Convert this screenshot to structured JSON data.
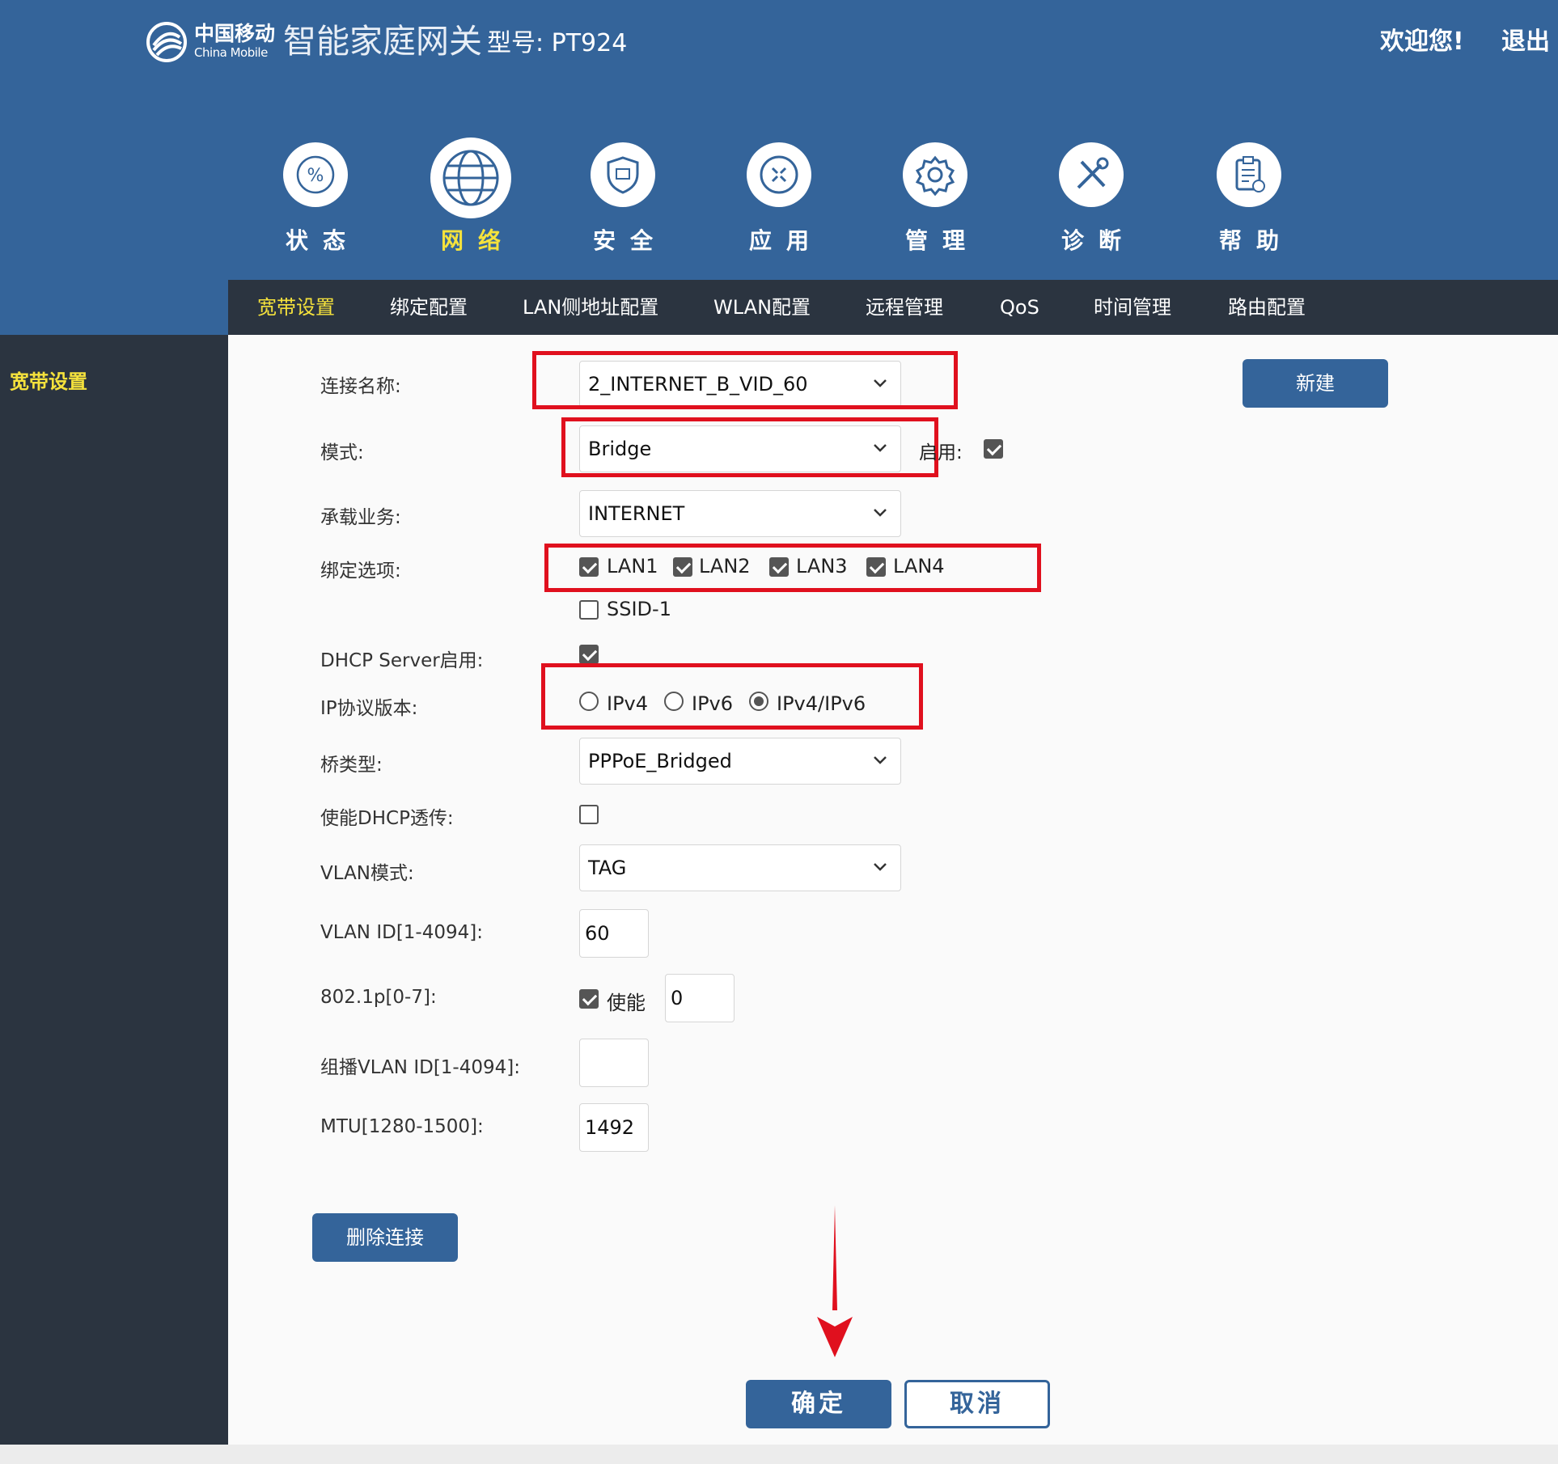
{
  "header": {
    "brand_cn": "中国移动",
    "brand_en": "China Mobile",
    "gateway_title": "智能家庭网关",
    "model": "型号: PT924",
    "welcome": "欢迎您!",
    "logout": "退出"
  },
  "nav": [
    {
      "label": "状态",
      "icon": "status-icon",
      "active": false
    },
    {
      "label": "网络",
      "icon": "globe-icon",
      "active": true
    },
    {
      "label": "安全",
      "icon": "shield-icon",
      "active": false
    },
    {
      "label": "应用",
      "icon": "apps-icon",
      "active": false
    },
    {
      "label": "管理",
      "icon": "gear-icon",
      "active": false
    },
    {
      "label": "诊断",
      "icon": "tools-icon",
      "active": false
    },
    {
      "label": "帮助",
      "icon": "clipboard-icon",
      "active": false
    }
  ],
  "subnav": [
    "宽带设置",
    "绑定配置",
    "LAN侧地址配置",
    "WLAN配置",
    "远程管理",
    "QoS",
    "时间管理",
    "路由配置"
  ],
  "sidebar": {
    "item": "宽带设置"
  },
  "form": {
    "connection_name_label": "连接名称:",
    "connection_name": "2_INTERNET_B_VID_60",
    "new_button": "新建",
    "mode_label": "模式:",
    "mode": "Bridge",
    "enable_label": "启用:",
    "service_label": "承载业务:",
    "service": "INTERNET",
    "binding_label": "绑定选项:",
    "binding_options": [
      "LAN1",
      "LAN2",
      "LAN3",
      "LAN4",
      "SSID-1"
    ],
    "dhcp_server_label": "DHCP Server启用:",
    "ip_version_label": "IP协议版本:",
    "ip_versions": [
      "IPv4",
      "IPv6",
      "IPv4/IPv6"
    ],
    "bridge_type_label": "桥类型:",
    "bridge_type": "PPPoE_Bridged",
    "dhcp_passthrough_label": "使能DHCP透传:",
    "vlan_mode_label": "VLAN模式:",
    "vlan_mode": "TAG",
    "vlan_id_label": "VLAN ID[1-4094]:",
    "vlan_id": "60",
    "p8021_label": "802.1p[0-7]:",
    "p8021_enable": "使能",
    "p8021_value": "0",
    "mcast_vlan_label": "组播VLAN ID[1-4094]:",
    "mcast_vlan": "",
    "mtu_label": "MTU[1280-1500]:",
    "mtu": "1492",
    "delete_button": "删除连接",
    "confirm_button": "确定",
    "cancel_button": "取消"
  },
  "colors": {
    "header": "#34649a",
    "dark": "#2b3440",
    "active": "#f5e23c",
    "highlight": "#e0101e"
  }
}
